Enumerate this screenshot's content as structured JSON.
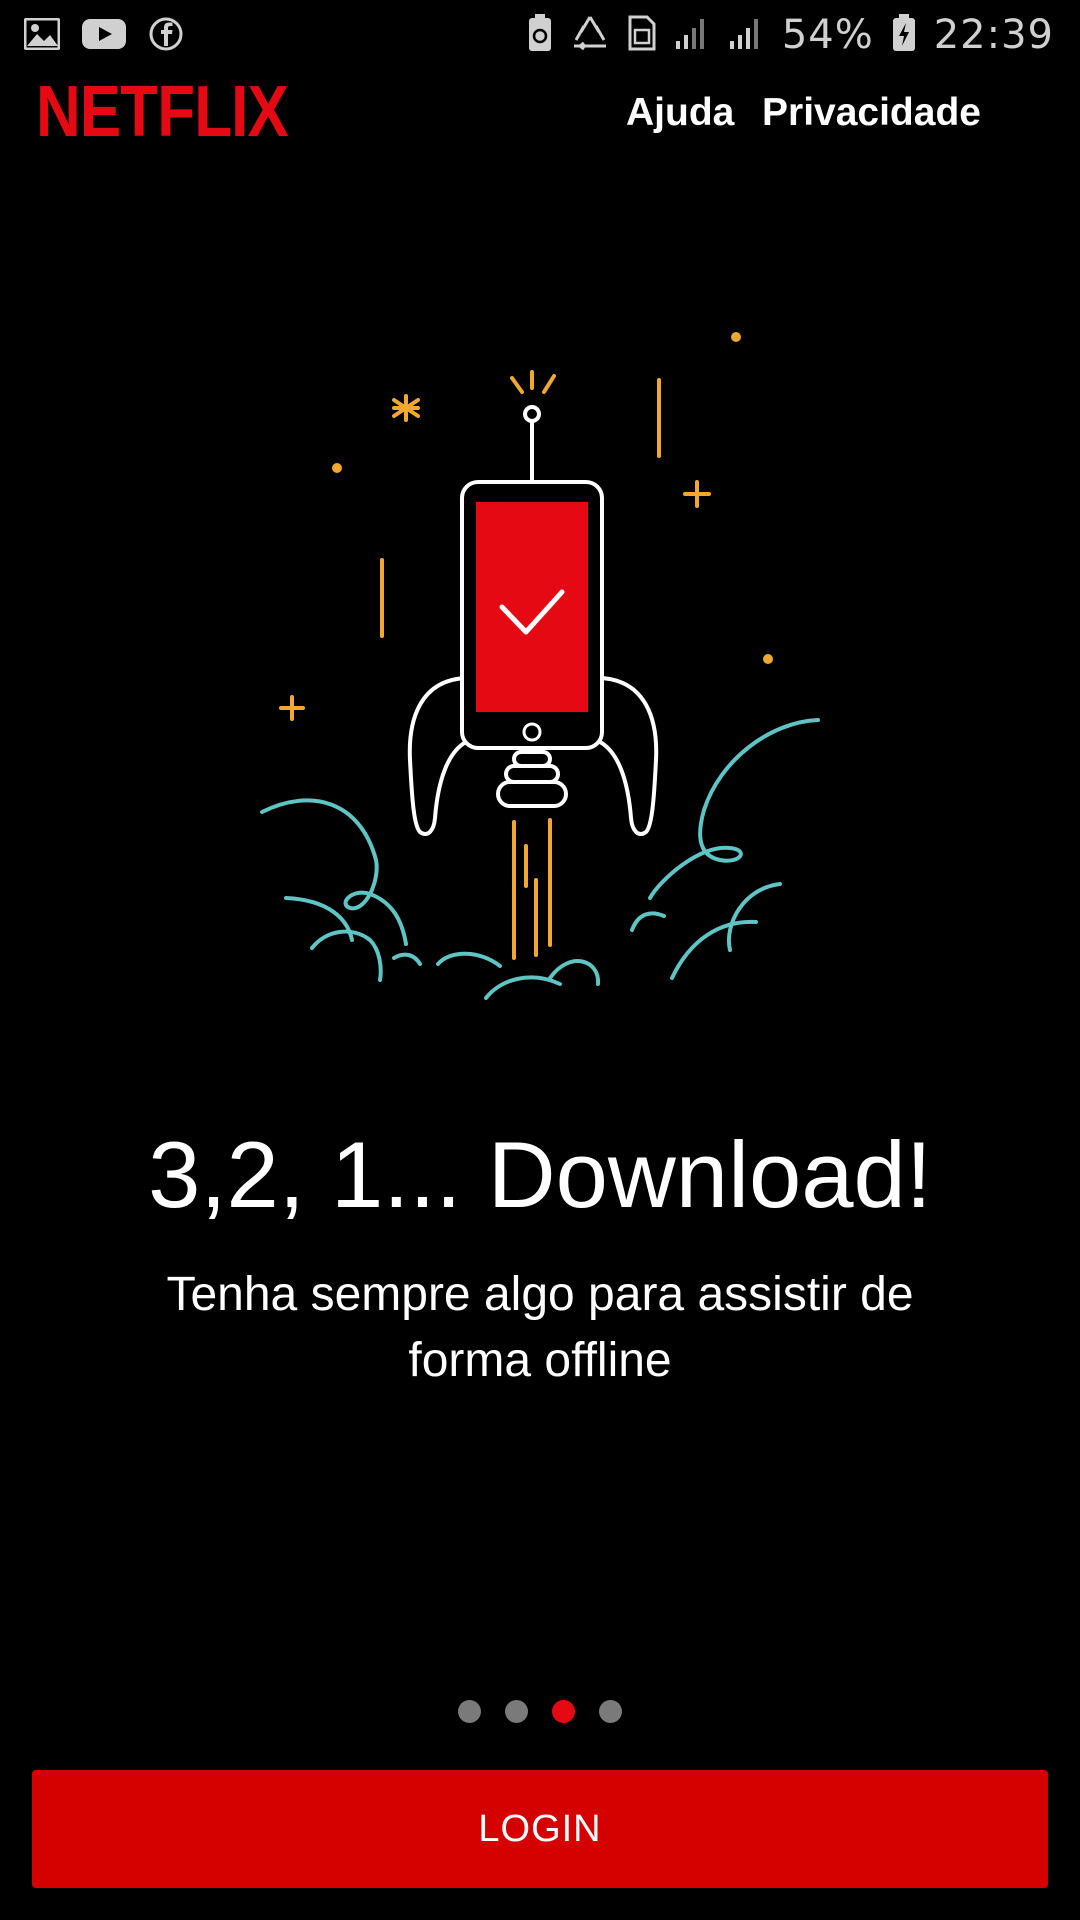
{
  "status_bar": {
    "battery_percent": "54%",
    "time": "22:39",
    "left_icons": [
      "gallery-icon",
      "youtube-icon",
      "facebook-icon"
    ],
    "right_icons": [
      "battery-saver-icon",
      "recycle-icon",
      "sim-icon",
      "signal-1-icon",
      "signal-2-icon",
      "battery-charging-icon"
    ]
  },
  "header": {
    "logo": "NETFLIX",
    "help_label": "Ajuda",
    "privacy_label": "Privacidade"
  },
  "slide": {
    "title": "3,2, 1... Download!",
    "subtitle": "Tenha sempre algo para assistir de forma offline",
    "illustration": "rocket-phone-icon"
  },
  "pagination": {
    "total": 4,
    "active_index": 2
  },
  "login_button": "LOGIN",
  "colors": {
    "brand_red": "#e50914",
    "button_red": "#d50000",
    "accent_orange": "#f0a830",
    "cloud_teal": "#5ec4c4",
    "dot_inactive": "#7a7a7a"
  }
}
